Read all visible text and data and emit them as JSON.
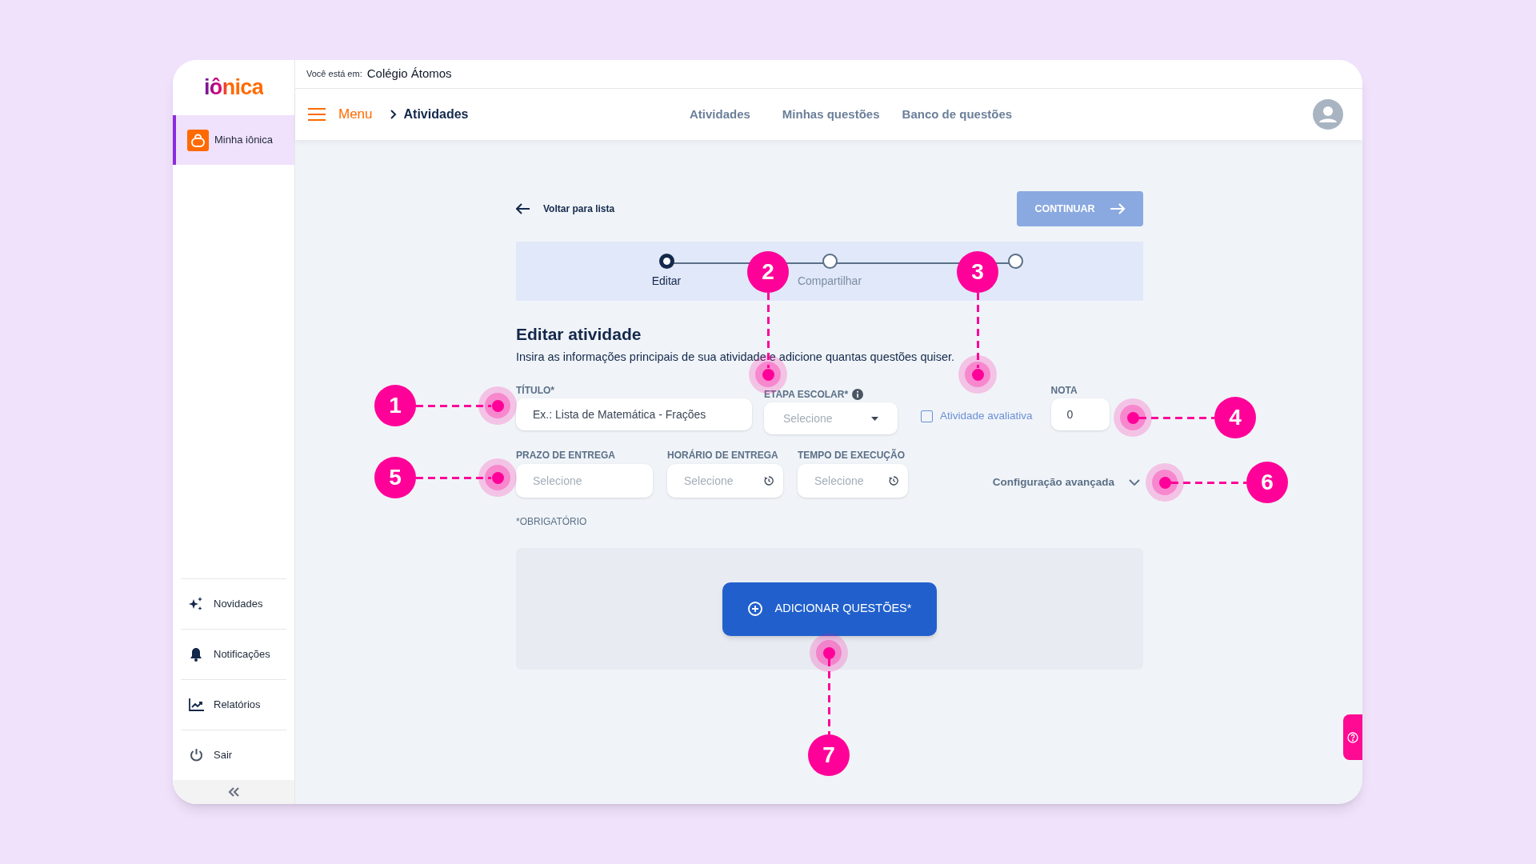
{
  "logo": {
    "text": "iônica"
  },
  "sidebar": {
    "items": [
      {
        "label": "Minha iônica",
        "selected": true
      }
    ],
    "bottom_items": [
      {
        "kind": "sparkles",
        "label": "Novidades"
      },
      {
        "kind": "bell",
        "label": "Notificações"
      },
      {
        "kind": "chart",
        "label": "Relatórios"
      },
      {
        "kind": "power",
        "label": "Sair"
      }
    ]
  },
  "location": {
    "prefix": "Você está em:",
    "school": "Colégio Átomos"
  },
  "header": {
    "menu": "Menu",
    "breadcrumb": "Atividades",
    "nav": [
      "Atividades",
      "Minhas questões",
      "Banco de questões"
    ]
  },
  "back_link": "Voltar para lista",
  "continue_button": "CONTINUAR",
  "steps": [
    {
      "label": "Editar",
      "selected": true
    },
    {
      "label": "Compartilhar",
      "selected": false
    },
    {
      "selected": false
    }
  ],
  "heading": "Editar atividade",
  "description": "Insira as informações principais de sua atividade e adicione quantas questões quiser.",
  "fields": {
    "title": {
      "label": "TÍTULO*",
      "placeholder": "Ex.: Lista de Matemática - Frações"
    },
    "stage": {
      "label": "ETAPA ESCOLAR*",
      "placeholder": "Selecione"
    },
    "evaluative": {
      "label": "Atividade avaliativa",
      "checked": false
    },
    "grade": {
      "label": "NOTA",
      "value": "0"
    },
    "deadline": {
      "label": "PRAZO DE ENTREGA",
      "placeholder": "Selecione"
    },
    "time": {
      "label": "HORÁRIO DE ENTREGA",
      "placeholder": "Selecione"
    },
    "duration": {
      "label": "TEMPO DE EXECUÇÃO",
      "placeholder": "Selecione"
    }
  },
  "advanced": "Configuração avançada",
  "required_note": "*OBRIGATÓRIO",
  "add_button": "ADICIONAR QUESTÕES*",
  "callouts": [
    {
      "label": "1"
    },
    {
      "label": "2"
    },
    {
      "label": "3"
    },
    {
      "label": "4"
    },
    {
      "label": "5"
    },
    {
      "label": "6"
    },
    {
      "label": "7"
    }
  ]
}
